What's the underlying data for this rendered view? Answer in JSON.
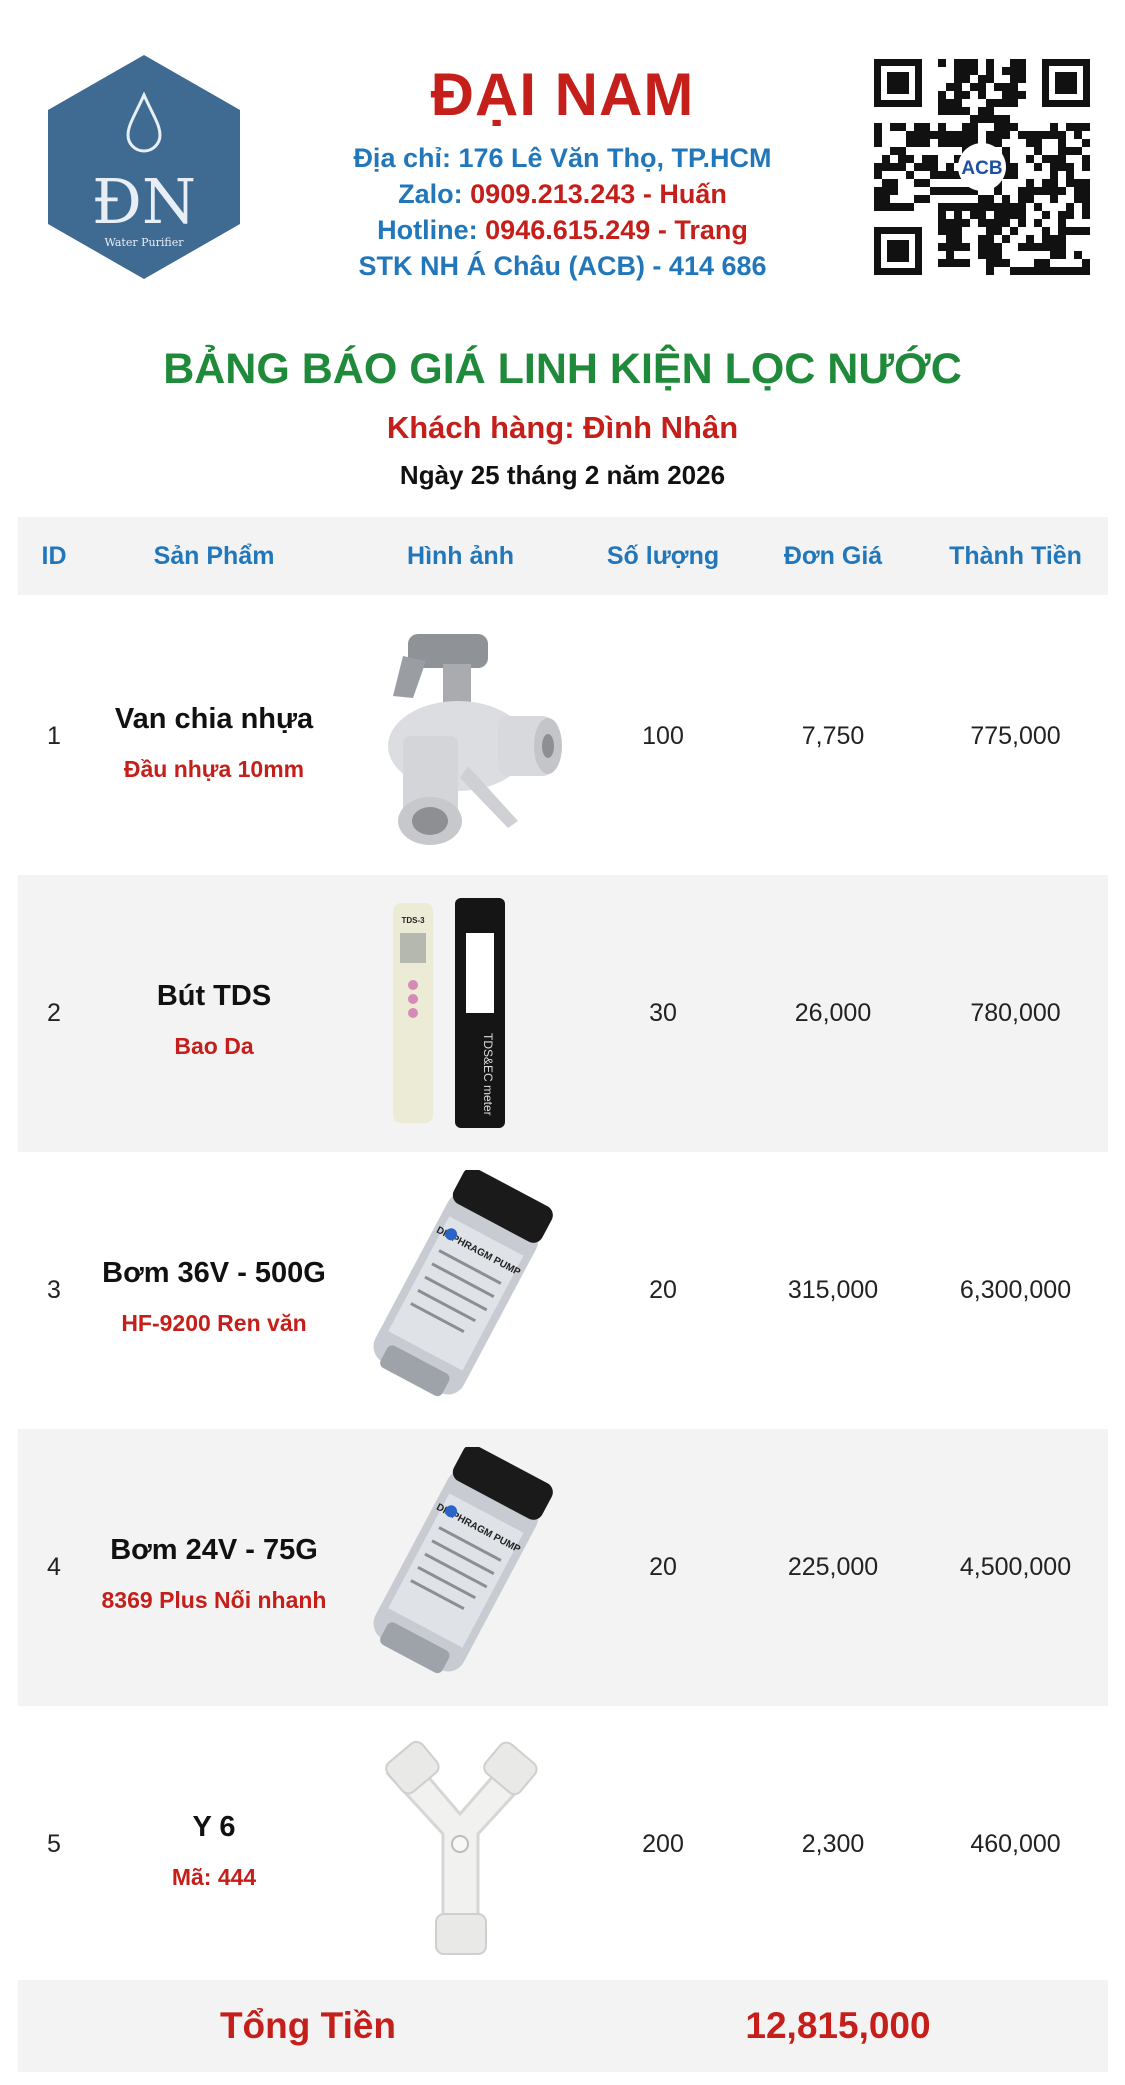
{
  "header": {
    "logo": {
      "letters": "ĐN",
      "tagline": "Water Purifier"
    },
    "company_name": "ĐẠI NAM",
    "address_label": "Địa chỉ: ",
    "address": "176 Lê Văn Thọ, TP.HCM",
    "zalo_label": "Zalo: ",
    "zalo": "0909.213.243 - Huấn",
    "hotline_label": "Hotline: ",
    "hotline": "0946.615.249 - Trang",
    "bank": "STK NH Á Châu (ACB) - 414 686",
    "qr_badge": "ACB"
  },
  "document": {
    "title": "BẢNG BÁO GIÁ LINH KIỆN LỌC NƯỚC",
    "customer": "Khách hàng: Đình Nhân",
    "date": "Ngày 25 tháng 2 năm 2026"
  },
  "table": {
    "columns": [
      "ID",
      "Sản Phẩm",
      "Hình ảnh",
      "Số lượng",
      "Đơn Giá",
      "Thành Tiền"
    ],
    "rows": [
      {
        "id": "1",
        "name": "Van chia nhựa",
        "desc": "Đầu nhựa 10mm",
        "image": "plastic-splitter-valve",
        "qty": "100",
        "price": "7,750",
        "total": "775,000"
      },
      {
        "id": "2",
        "name": "Bút TDS",
        "desc": "Bao Da",
        "image": "tds-pen-with-leather-case",
        "qty": "30",
        "price": "26,000",
        "total": "780,000"
      },
      {
        "id": "3",
        "name": "Bơm 36V - 500G",
        "desc": "HF-9200 Ren văn",
        "image": "booster-pump",
        "qty": "20",
        "price": "315,000",
        "total": "6,300,000"
      },
      {
        "id": "4",
        "name": "Bơm 24V - 75G",
        "desc": "8369 Plus Nối nhanh",
        "image": "booster-pump",
        "qty": "20",
        "price": "225,000",
        "total": "4,500,000"
      },
      {
        "id": "5",
        "name": "Y 6",
        "desc": "Mã: 444",
        "image": "y-connector",
        "qty": "200",
        "price": "2,300",
        "total": "460,000"
      }
    ],
    "total_label": "Tổng Tiền",
    "total_value": "12,815,000"
  },
  "pic_labels": {
    "tds_pen": "TDS-3",
    "tds_case": "TDS&EC meter",
    "pump": "DIAPHRAGM PUMP"
  },
  "colors": {
    "brand_red": "#c41f1a",
    "brand_blue": "#2277bb",
    "title_green": "#1f8a3a",
    "row_shade": "#f3f3f3",
    "logo_blue": "#3f6a92"
  }
}
